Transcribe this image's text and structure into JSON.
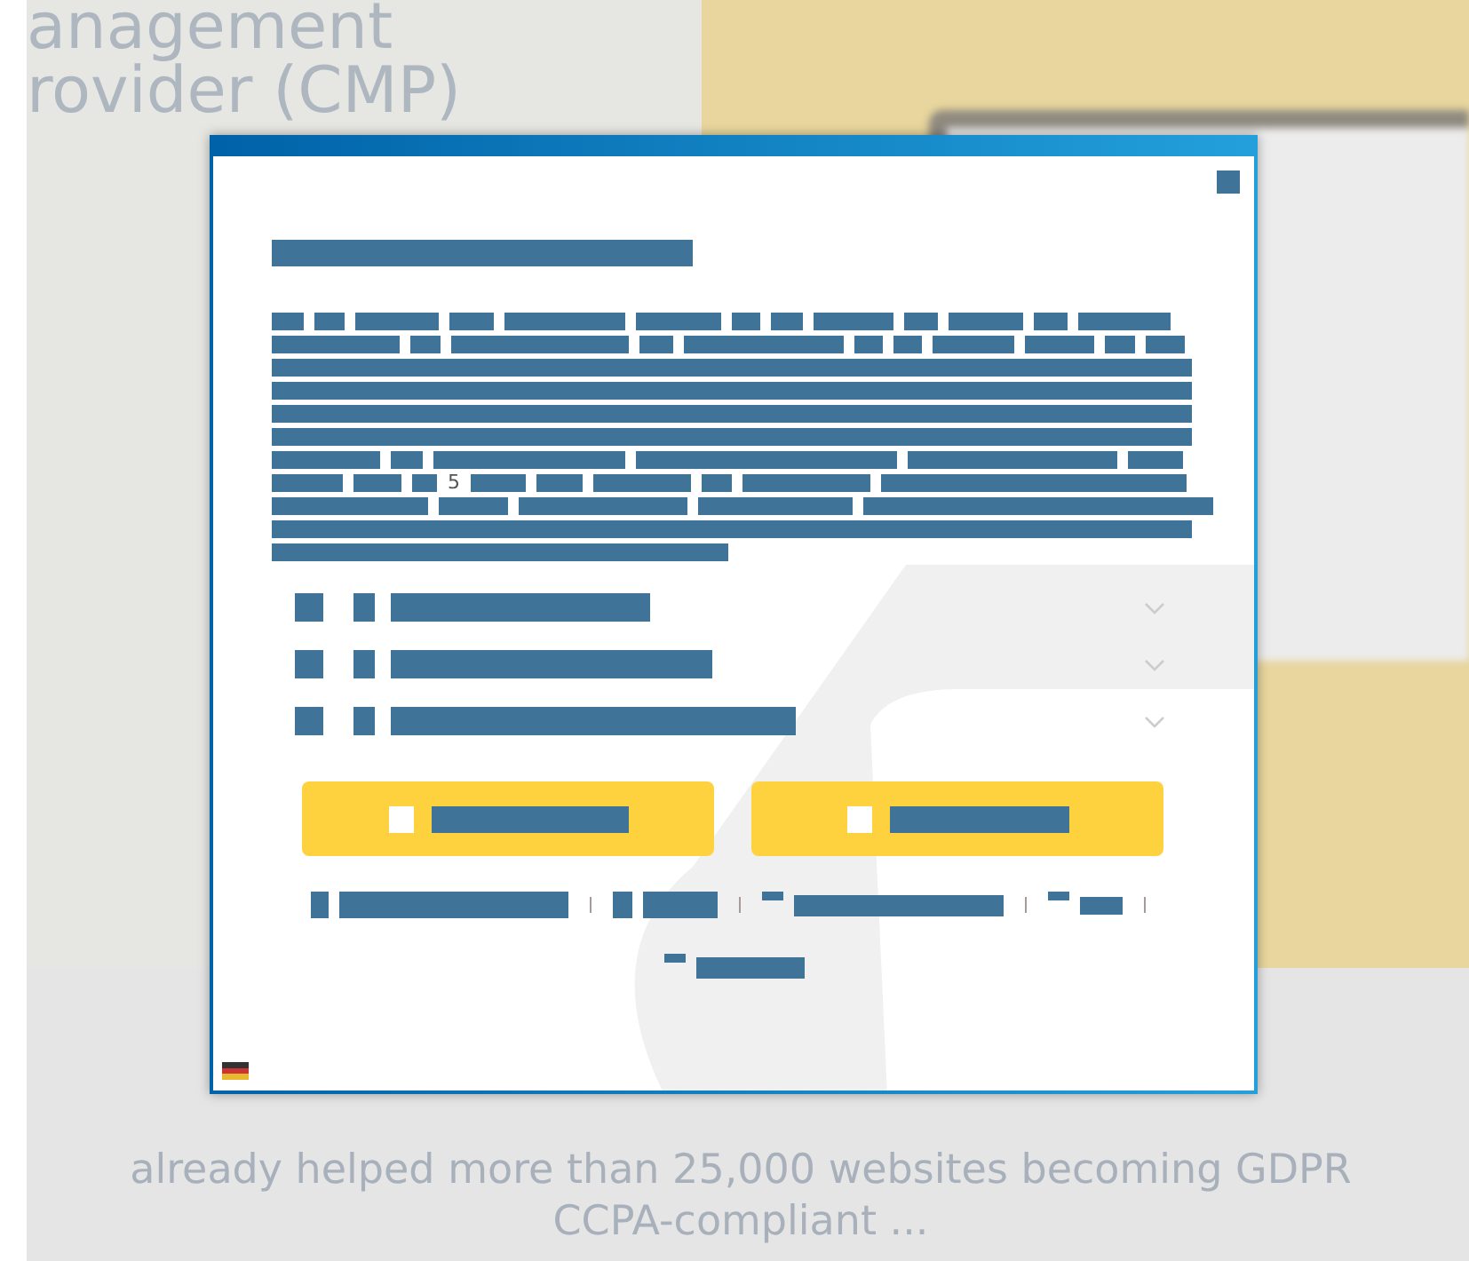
{
  "background": {
    "heading_lines": [
      "anagement",
      "rovider (CMP)"
    ],
    "tagline_lines": [
      "already helped more than 25,000 websites becoming GDPR",
      "CCPA-compliant ..."
    ]
  },
  "dialog": {
    "inline_number": "5",
    "sections": [
      {
        "expanded": false
      },
      {
        "expanded": false
      },
      {
        "expanded": false
      }
    ]
  }
}
